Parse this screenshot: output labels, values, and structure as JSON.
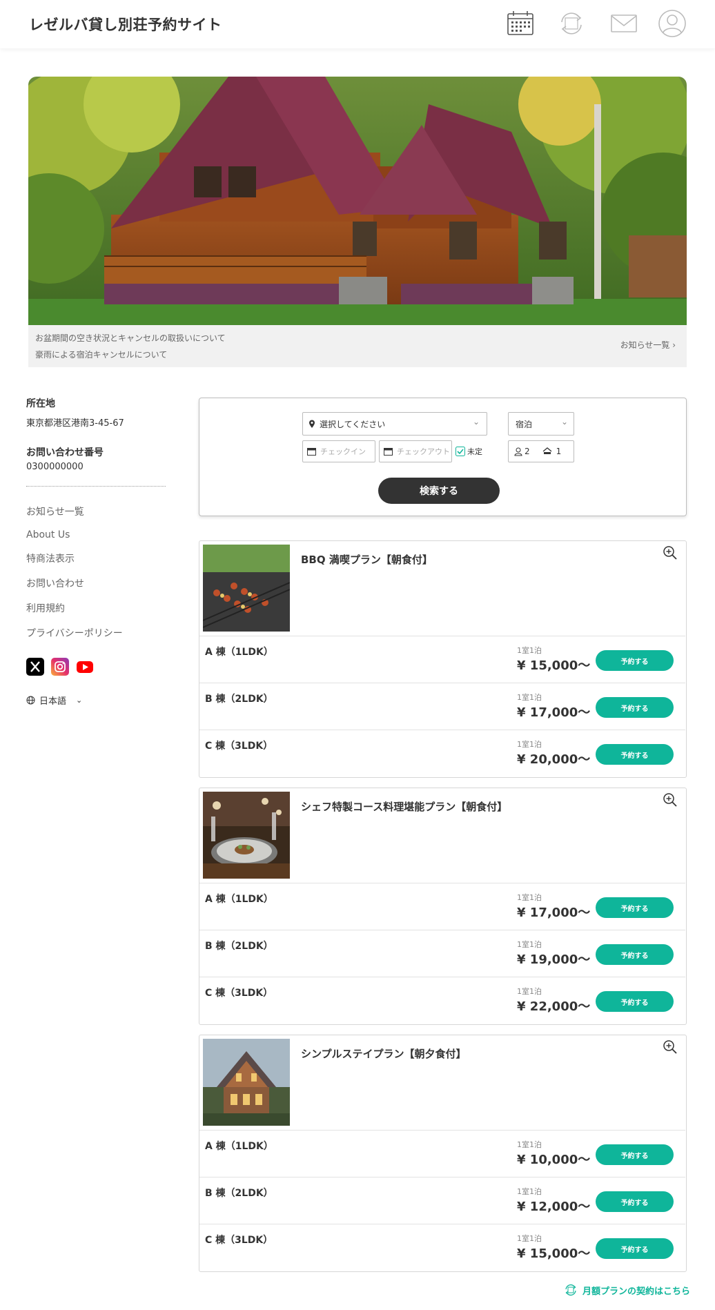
{
  "header": {
    "site_title": "レゼルバ貸し別荘予約サイト",
    "icons": [
      "calendar-icon",
      "refresh-icon",
      "mail-icon",
      "user-icon"
    ]
  },
  "news": {
    "items": [
      "お盆期間の空き状況とキャンセルの取扱いについて",
      "豪雨による宿泊キャンセルについて"
    ],
    "list_link": "お知らせ一覧 ›"
  },
  "sidebar": {
    "location_label": "所在地",
    "address": "東京都港区港南3-45-67",
    "phone_label": "お問い合わせ番号",
    "phone": "0300000000",
    "links": [
      "お知らせ一覧",
      "About Us",
      "特商法表示",
      "お問い合わせ",
      "利用規約",
      "プライバシーポリシー"
    ],
    "language": "日本語"
  },
  "search": {
    "location_placeholder": "選択してください",
    "stay_type": "宿泊",
    "checkin_placeholder": "チェックイン",
    "checkout_placeholder": "チェックアウト",
    "undecided_label": "未定",
    "guests": "2",
    "rooms": "1",
    "button_label": "検索する"
  },
  "plans": [
    {
      "title": "BBQ 満喫プラン【朝食付】",
      "rooms": [
        {
          "name": "A 棟（1LDK）",
          "unit": "1室1泊",
          "price": "¥ 15,000〜",
          "button": "予約する"
        },
        {
          "name": "B 棟（2LDK）",
          "unit": "1室1泊",
          "price": "¥ 17,000〜",
          "button": "予約する"
        },
        {
          "name": "C 棟（3LDK）",
          "unit": "1室1泊",
          "price": "¥ 20,000〜",
          "button": "予約する"
        }
      ]
    },
    {
      "title": "シェフ特製コース料理堪能プラン【朝食付】",
      "rooms": [
        {
          "name": "A 棟（1LDK）",
          "unit": "1室1泊",
          "price": "¥ 17,000〜",
          "button": "予約する"
        },
        {
          "name": "B 棟（2LDK）",
          "unit": "1室1泊",
          "price": "¥ 19,000〜",
          "button": "予約する"
        },
        {
          "name": "C 棟（3LDK）",
          "unit": "1室1泊",
          "price": "¥ 22,000〜",
          "button": "予約する"
        }
      ]
    },
    {
      "title": "シンプルステイプラン【朝夕食付】",
      "rooms": [
        {
          "name": "A 棟（1LDK）",
          "unit": "1室1泊",
          "price": "¥ 10,000〜",
          "button": "予約する"
        },
        {
          "name": "B 棟（2LDK）",
          "unit": "1室1泊",
          "price": "¥ 12,000〜",
          "button": "予約する"
        },
        {
          "name": "C 棟（3LDK）",
          "unit": "1室1泊",
          "price": "¥ 15,000〜",
          "button": "予約する"
        }
      ]
    }
  ],
  "footer": {
    "monthly_link": "月額プランの契約はこちら"
  },
  "colors": {
    "accent": "#0fb59a",
    "dark_button": "#333333"
  }
}
